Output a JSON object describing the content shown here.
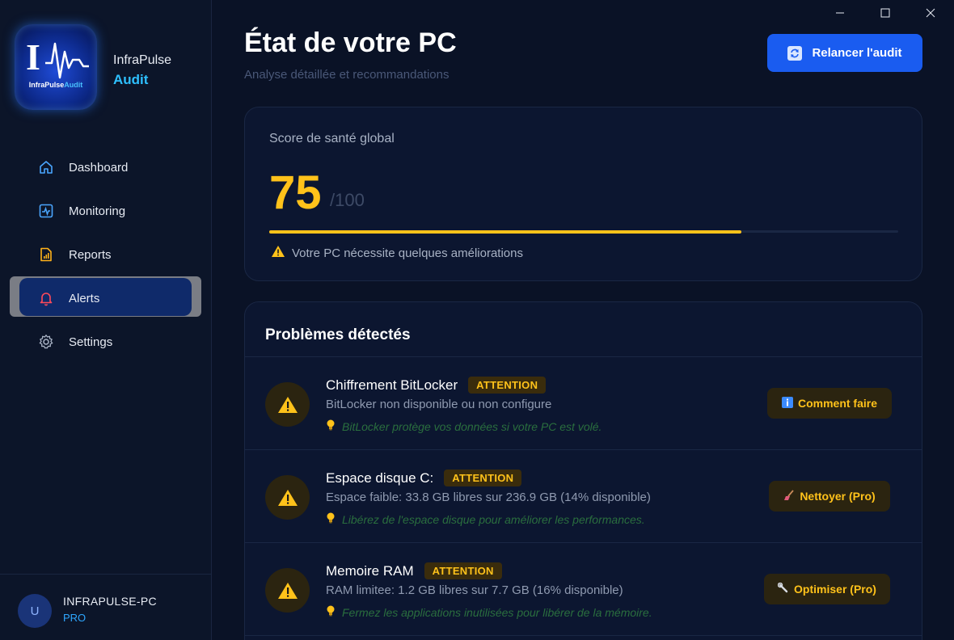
{
  "window": {
    "minimize": "—",
    "maximize": "☐",
    "close": "✕"
  },
  "brand": {
    "name": "InfraPulse",
    "product": "Audit",
    "logo_caption_main": "InfraPulse",
    "logo_caption_accent": "Audit",
    "logo_letter": "I"
  },
  "nav": {
    "items": [
      {
        "label": "Dashboard",
        "icon": "home-icon"
      },
      {
        "label": "Monitoring",
        "icon": "monitoring-icon"
      },
      {
        "label": "Reports",
        "icon": "report-icon"
      },
      {
        "label": "Alerts",
        "icon": "bell-icon",
        "active": true
      },
      {
        "label": "Settings",
        "icon": "gear-icon"
      }
    ]
  },
  "user": {
    "initial": "U",
    "pc_name": "INFRAPULSE-PC",
    "plan": "PRO"
  },
  "header": {
    "title": "État de votre PC",
    "subtitle": "Analyse détaillée et recommandations",
    "relaunch_label": "Relancer l'audit"
  },
  "score": {
    "label": "Score de santé global",
    "value": "75",
    "max": "/100",
    "progress_fraction": 0.75,
    "message": "Votre PC nécessite quelques améliorations"
  },
  "issues": {
    "title": "Problèmes détectés",
    "items": [
      {
        "title": "Chiffrement BitLocker",
        "badge": "ATTENTION",
        "description": "BitLocker non disponible ou non configure",
        "tip": "BitLocker protège vos données si votre PC est volé.",
        "action_label": "Comment faire",
        "action_icon": "info-icon"
      },
      {
        "title": "Espace disque C:",
        "badge": "ATTENTION",
        "description": "Espace faible: 33.8 GB libres sur 236.9 GB (14% disponible)",
        "tip": "Libérez de l'espace disque pour améliorer les performances.",
        "action_label": "Nettoyer (Pro)",
        "action_icon": "broom-icon"
      },
      {
        "title": "Memoire RAM",
        "badge": "ATTENTION",
        "description": "RAM limitee: 1.2 GB libres sur 7.7 GB (16% disponible)",
        "tip": "Fermez les applications inutilisées pour libérer de la mémoire.",
        "action_label": "Optimiser (Pro)",
        "action_icon": "wrench-icon"
      }
    ]
  },
  "colors": {
    "accent_blue": "#1a5cf0",
    "warning": "#ffc21a",
    "tip_green": "#2a6e3e",
    "brand_cyan": "#2ec0ff"
  }
}
